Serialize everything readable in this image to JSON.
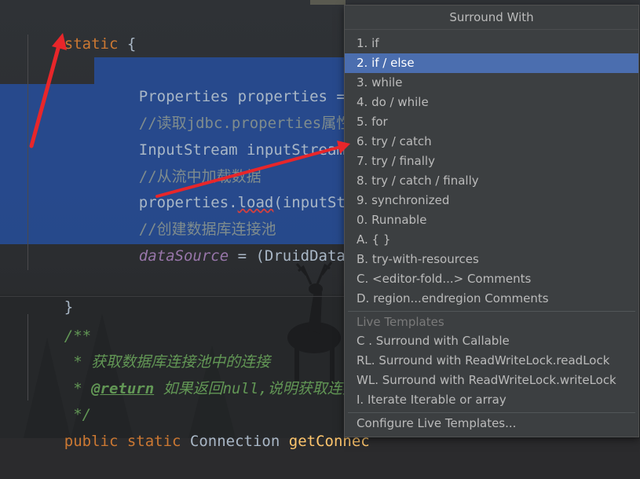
{
  "editor": {
    "lines": {
      "l1": {
        "kw_static": "static",
        "brace": " {"
      },
      "l2": {
        "text": "Properties properties = ne"
      },
      "l3": {
        "text": "//读取jdbc.properties属性配"
      },
      "l4": {
        "text": "InputStream inputStream = "
      },
      "l5": {
        "text": "//从流中加载数据"
      },
      "l6": {
        "pre": "properties.",
        "squig": "load",
        "post": "(inputStrea"
      },
      "l7": {
        "text": "//创建数据库连接池"
      },
      "l8": {
        "field": "dataSource",
        "post": " = (DruidDataSou"
      },
      "l9": {
        "text": "}"
      },
      "l10": {
        "text": "/**"
      },
      "l11": {
        "text": " * 获取数据库连接池中的连接"
      },
      "l12": {
        "pre": " * ",
        "tag": "@return",
        "post": " 如果返回null,说明获取连接失"
      },
      "l13": {
        "text": " */"
      },
      "l14": {
        "kw": "public static ",
        "type": "Connection ",
        "method": "getConnec"
      }
    }
  },
  "popup": {
    "title": "Surround With",
    "items": [
      {
        "label": "1. if"
      },
      {
        "label": "2. if / else"
      },
      {
        "label": "3. while"
      },
      {
        "label": "4. do / while"
      },
      {
        "label": "5. for"
      },
      {
        "label": "6. try / catch"
      },
      {
        "label": "7. try / finally"
      },
      {
        "label": "8. try / catch / finally"
      },
      {
        "label": "9. synchronized"
      },
      {
        "label": "0. Runnable"
      },
      {
        "label": "A. { }"
      },
      {
        "label": "B. try-with-resources"
      },
      {
        "label": "C. <editor-fold...> Comments"
      },
      {
        "label": "D. region...endregion Comments"
      }
    ],
    "selected_item": "2. if / else",
    "live_templates_header": "Live Templates",
    "live_templates": [
      {
        "label": "C . Surround with Callable"
      },
      {
        "label": "RL. Surround with ReadWriteLock.readLock"
      },
      {
        "label": "WL. Surround with ReadWriteLock.writeLock"
      },
      {
        "label": "I. Iterate Iterable or array"
      }
    ],
    "configure": "Configure Live Templates..."
  },
  "colors": {
    "selection": "#264fa0",
    "menu_selected": "#4b6eaf",
    "keyword": "#cc7832",
    "arrow": "#e8262a"
  }
}
